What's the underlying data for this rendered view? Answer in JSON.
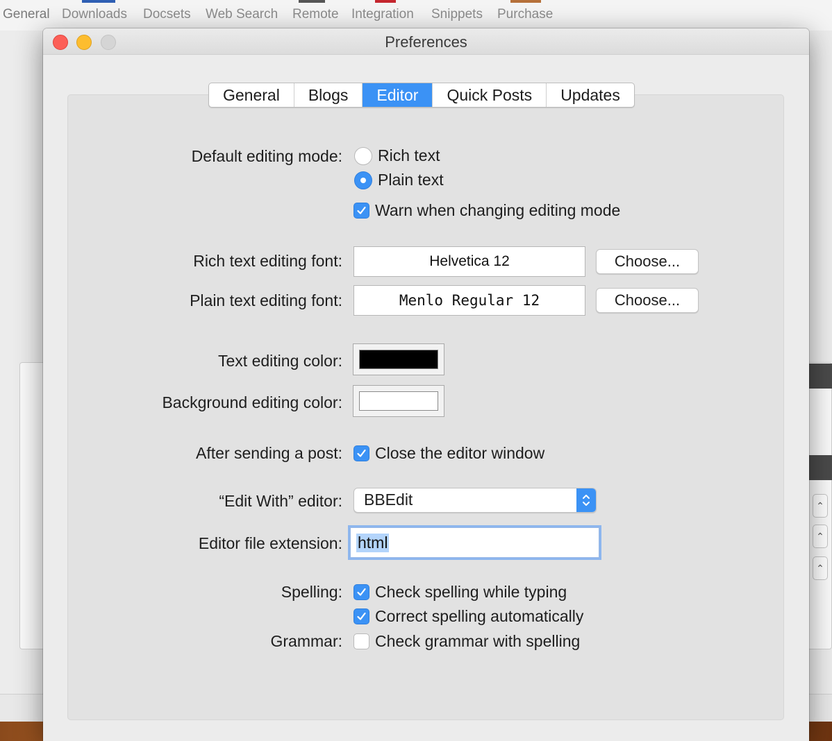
{
  "background_app": {
    "tabs": [
      "General",
      "Downloads",
      "Docsets",
      "Web Search",
      "Remote",
      "Integration",
      "Snippets",
      "Purchase"
    ],
    "active_tab": "General"
  },
  "window": {
    "title": "Preferences"
  },
  "tabs": [
    {
      "label": "General",
      "active": false
    },
    {
      "label": "Blogs",
      "active": false
    },
    {
      "label": "Editor",
      "active": true
    },
    {
      "label": "Quick Posts",
      "active": false
    },
    {
      "label": "Updates",
      "active": false
    }
  ],
  "editing_mode": {
    "label": "Default editing mode:",
    "options": [
      {
        "label": "Rich text",
        "selected": false
      },
      {
        "label": "Plain text",
        "selected": true
      }
    ],
    "warn": {
      "label": "Warn when changing editing mode",
      "checked": true
    }
  },
  "fonts": {
    "rich_label": "Rich text editing font:",
    "rich_value": "Helvetica 12",
    "plain_label": "Plain text editing font:",
    "plain_value": "Menlo Regular 12",
    "choose_label": "Choose..."
  },
  "colors": {
    "text_label": "Text editing color:",
    "text_color": "#000000",
    "background_label": "Background editing color:",
    "background_color": "#ffffff",
    "accent": "#3b92f5"
  },
  "after_send": {
    "label": "After sending a post:",
    "option_label": "Close the editor window",
    "checked": true
  },
  "edit_with": {
    "label": "“Edit With” editor:",
    "value": "BBEdit"
  },
  "file_extension": {
    "label": "Editor file extension:",
    "value": "html"
  },
  "spelling": {
    "label": "Spelling:",
    "check_typing": {
      "label": "Check spelling while typing",
      "checked": true
    },
    "correct_auto": {
      "label": "Correct spelling automatically",
      "checked": true
    }
  },
  "grammar": {
    "label": "Grammar:",
    "check_grammar": {
      "label": "Check grammar with spelling",
      "checked": false
    }
  },
  "icons": [
    "checkmark-icon",
    "up-down-chevron-icon"
  ]
}
